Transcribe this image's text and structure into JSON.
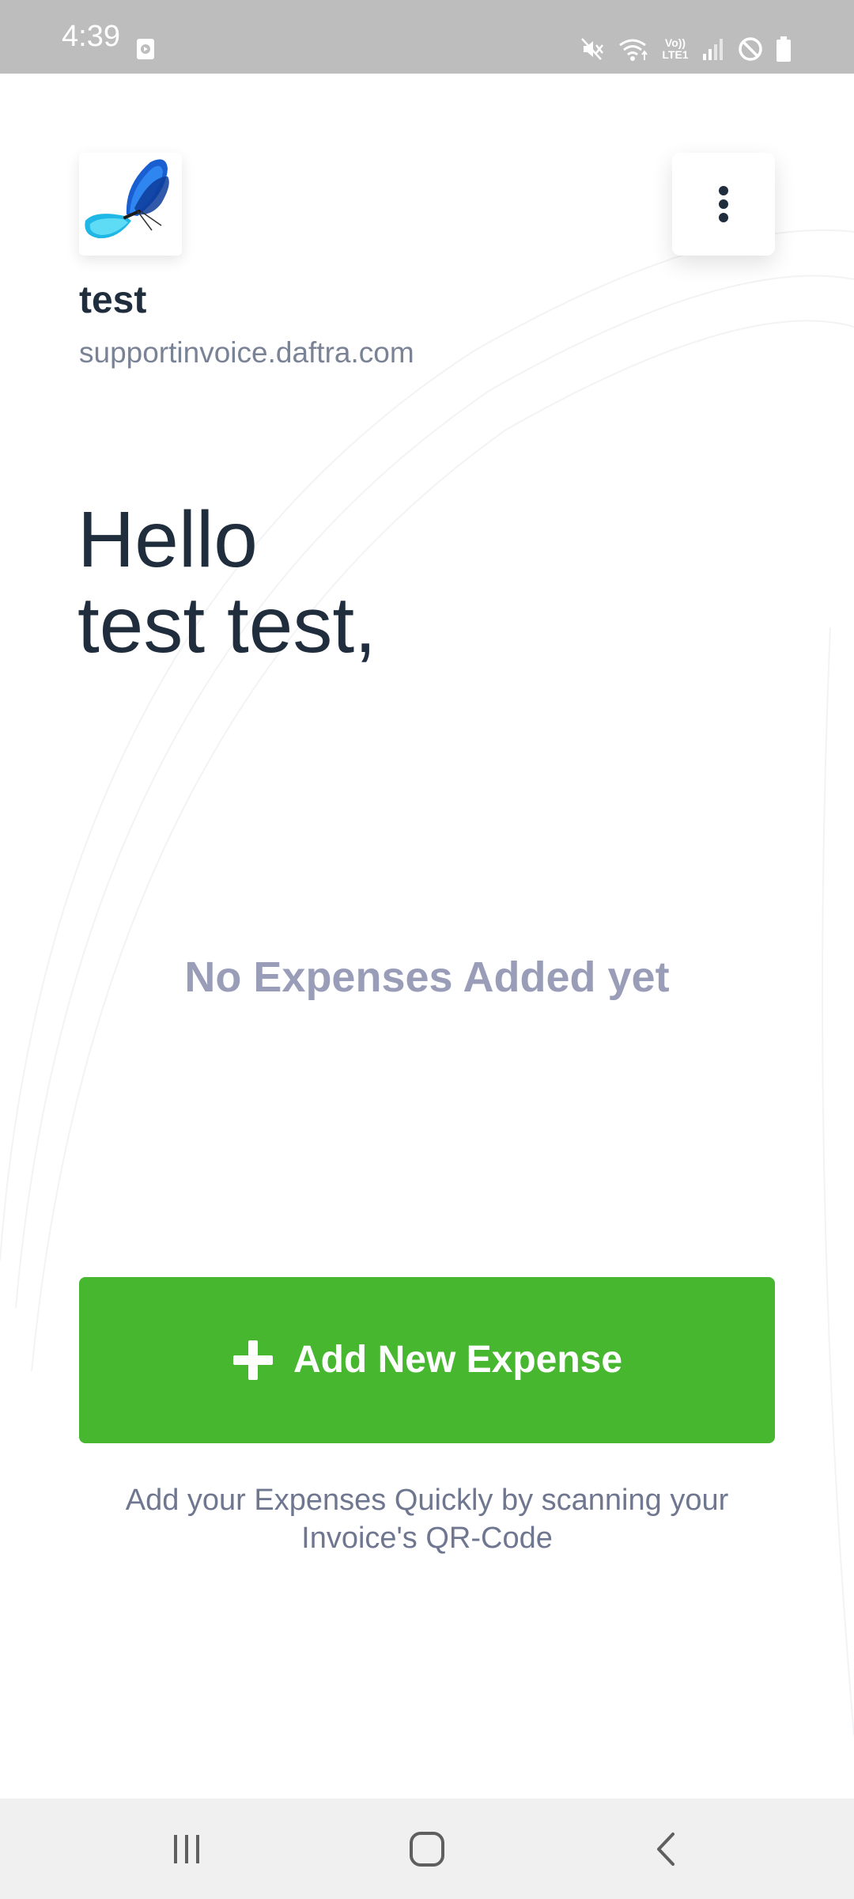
{
  "status_bar": {
    "time": "4:39",
    "icons": [
      "media-icon",
      "mute-icon",
      "wifi-icon",
      "volte-lte-icon",
      "signal-icon",
      "do-not-disturb-icon",
      "battery-icon"
    ],
    "lte_text": "Vo)) LTE1"
  },
  "header": {
    "logo_icon": "butterfly-logo",
    "menu_icon": "more-vert-icon",
    "company_name": "test",
    "company_domain": "supportinvoice.daftra.com"
  },
  "greeting": {
    "line1": "Hello",
    "line2": "test test,"
  },
  "expenses": {
    "empty_message": "No Expenses Added yet"
  },
  "actions": {
    "add_icon": "plus-icon",
    "add_label": "Add New Expense",
    "hint": "Add your Expenses Quickly by scanning your Invoice's QR-Code"
  },
  "nav_bar": {
    "icons": [
      "recent-apps-icon",
      "home-icon",
      "back-icon"
    ]
  },
  "colors": {
    "status_bar_bg": "#bdbdbd",
    "primary_text": "#1f2d3d",
    "muted_text": "#7a8295",
    "empty_state": "#9a9db8",
    "accent_green": "#46b72f",
    "nav_bar_bg": "#f0f0f0"
  }
}
